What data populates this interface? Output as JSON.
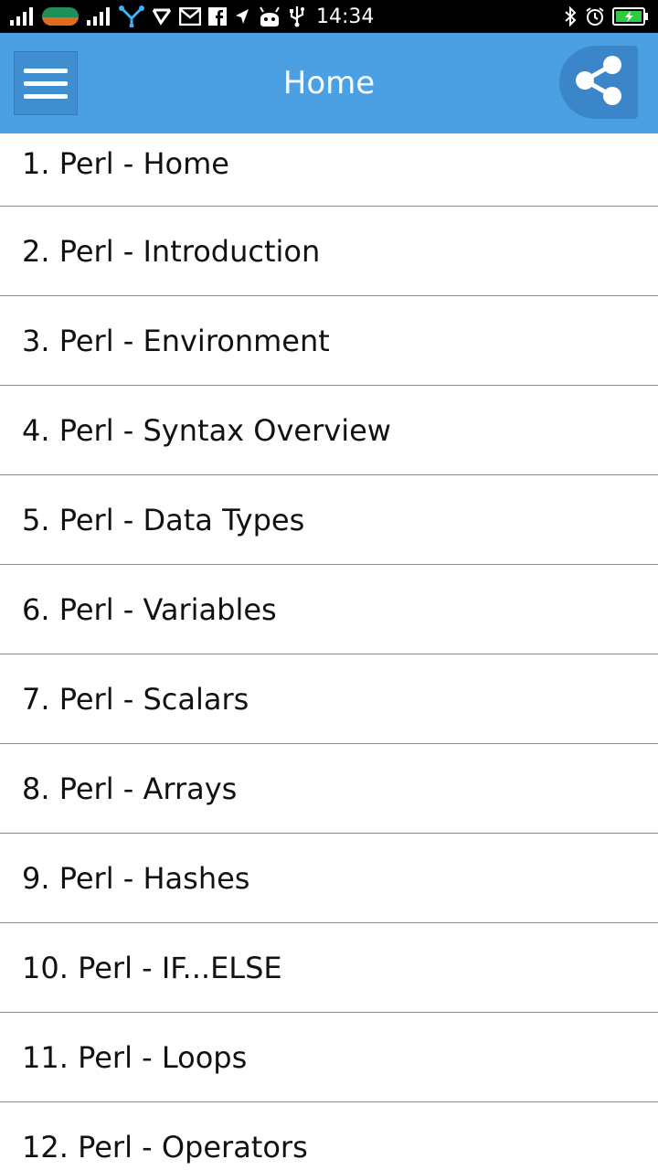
{
  "status_bar": {
    "time": "14:34",
    "icons": [
      "signal-icon",
      "carrier-logo-icon",
      "signal-icon",
      "network-share-icon",
      "check-icon",
      "gmail-icon",
      "facebook-icon",
      "navigation-icon",
      "android-icon",
      "usb-icon",
      "bluetooth-icon",
      "alarm-icon",
      "battery-charging-icon"
    ]
  },
  "app_bar": {
    "title": "Home",
    "menu_icon": "hamburger-menu-icon",
    "share_icon": "share-icon"
  },
  "list": {
    "items": [
      {
        "label": "1. Perl - Home"
      },
      {
        "label": "2. Perl - Introduction"
      },
      {
        "label": "3. Perl - Environment"
      },
      {
        "label": "4. Perl - Syntax Overview"
      },
      {
        "label": "5. Perl - Data Types"
      },
      {
        "label": "6. Perl - Variables"
      },
      {
        "label": "7. Perl - Scalars"
      },
      {
        "label": "8. Perl - Arrays"
      },
      {
        "label": "9. Perl - Hashes"
      },
      {
        "label": "10. Perl - IF...ELSE"
      },
      {
        "label": "11. Perl - Loops"
      },
      {
        "label": "12. Perl - Operators"
      }
    ]
  },
  "colors": {
    "app_bar": "#4aa0e2",
    "status_bar": "#000000",
    "divider": "#8a8a8a"
  }
}
